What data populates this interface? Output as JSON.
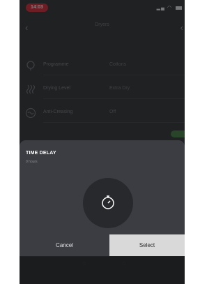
{
  "status_bar": {
    "time": "14:03"
  },
  "header": {
    "title": "Dryers",
    "back_icon": "chevron-left-icon"
  },
  "settings": [
    {
      "label": "Programme",
      "value": "Cottons",
      "icon": "programme-icon"
    },
    {
      "label": "Drying Level",
      "value": "Extra Dry",
      "icon": "drying-level-icon"
    },
    {
      "label": "Anti-Creasing",
      "value": "Off",
      "icon": "anti-creasing-icon"
    }
  ],
  "sheet": {
    "title": "TIME DELAY",
    "subtitle": "0 hours",
    "icon": "timer-icon"
  },
  "actions": {
    "cancel_label": "Cancel",
    "select_label": "Select"
  },
  "colors": {
    "status_pill": "#d8232f",
    "sheet_bg": "#3c3d42",
    "select_bg": "#d9d9d9",
    "toggle_on": "#3c7b3a"
  }
}
